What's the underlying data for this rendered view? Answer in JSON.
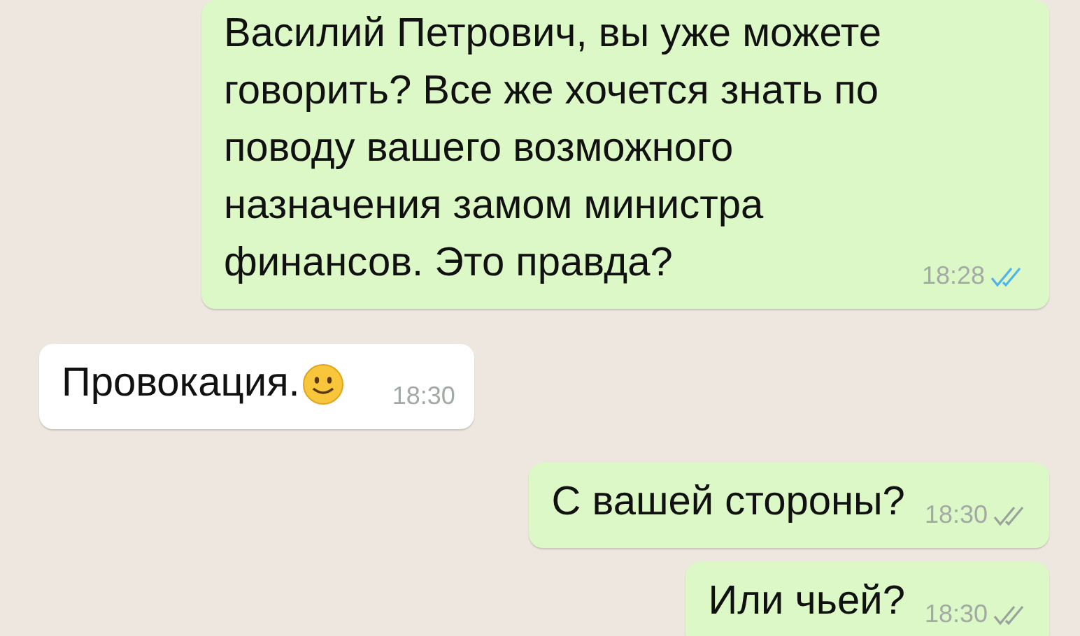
{
  "messages": [
    {
      "outgoing": true,
      "text": "Василий Петрович, вы уже можете говорить? Все же хочется знать по поводу вашего возможного назначения замом министра финансов. Это правда?",
      "time": "18:28",
      "read": true,
      "has_emoji": false
    },
    {
      "outgoing": false,
      "text": "Провокация.",
      "time": "18:30",
      "has_emoji": true
    },
    {
      "outgoing": true,
      "text": "С вашей стороны?",
      "time": "18:30",
      "read": false,
      "has_emoji": false
    },
    {
      "outgoing": true,
      "text": "Или чьей?",
      "time": "18:30",
      "read": false,
      "has_emoji": false
    }
  ]
}
